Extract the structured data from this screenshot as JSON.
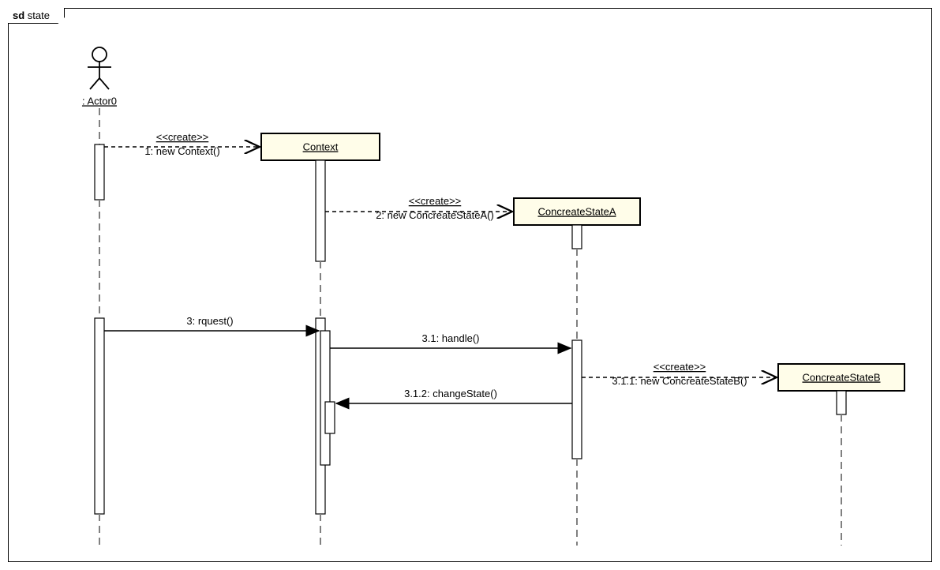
{
  "frame": {
    "prefix": "sd",
    "name": "state"
  },
  "participants": {
    "actor": {
      "label": ": Actor0"
    },
    "context": {
      "label": "Context"
    },
    "stateA": {
      "label": "ConcreateStateA"
    },
    "stateB": {
      "label": "ConcreateStateB"
    }
  },
  "messages": {
    "m1_stereo": "<<create>>",
    "m1": "1: new Context()",
    "m2_stereo": "<<create>>",
    "m2": "2: new ConcreateStateA()",
    "m3": "3: rquest()",
    "m3_1": "3.1: handle()",
    "m3_1_1_stereo": "<<create>>",
    "m3_1_1": "3.1.1: new ConcreateStateB()",
    "m3_1_2": "3.1.2: changeState()"
  }
}
